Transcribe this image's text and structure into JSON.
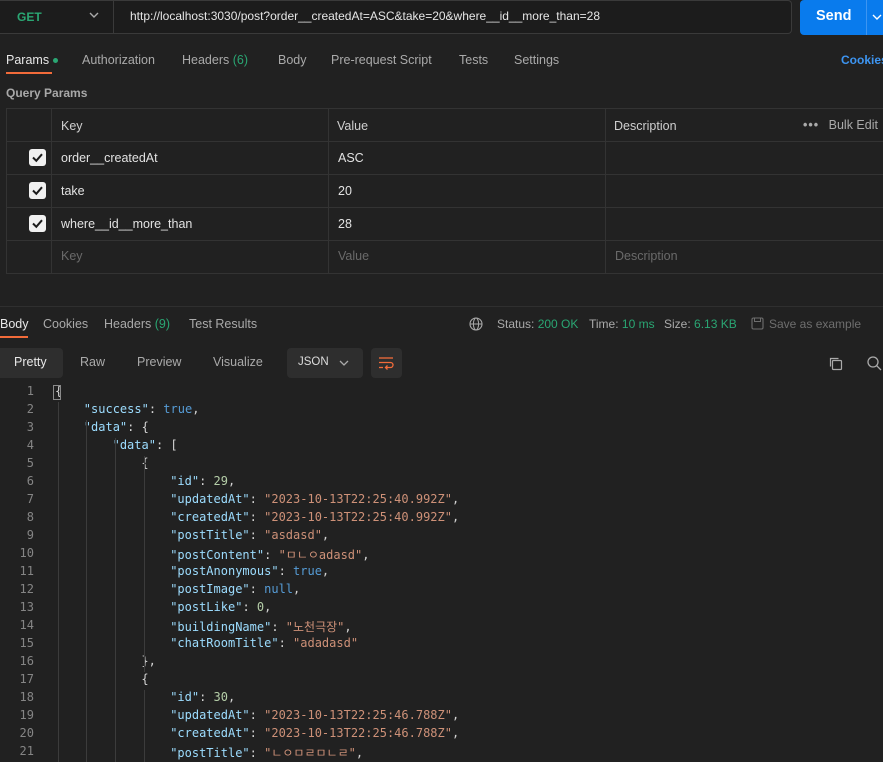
{
  "request": {
    "method": "GET",
    "url": "http://localhost:3030/post?order__createdAt=ASC&take=20&where__id__more_than=28",
    "send_label": "Send"
  },
  "tabs": {
    "params": "Params",
    "authorization": "Authorization",
    "headers": "Headers",
    "headers_count": "(6)",
    "body": "Body",
    "pre_request": "Pre-request Script",
    "tests": "Tests",
    "settings": "Settings",
    "cookies": "Cookies"
  },
  "query_params": {
    "title": "Query Params",
    "columns": {
      "key": "Key",
      "value": "Value",
      "description": "Description"
    },
    "bulk_edit": "Bulk Edit",
    "rows": [
      {
        "key": "order__createdAt",
        "value": "ASC",
        "checked": true
      },
      {
        "key": "take",
        "value": "20",
        "checked": true
      },
      {
        "key": "where__id__more_than",
        "value": "28",
        "checked": true
      }
    ],
    "placeholder": {
      "key": "Key",
      "value": "Value",
      "description": "Description"
    }
  },
  "response": {
    "tabs": {
      "body": "Body",
      "cookies": "Cookies",
      "headers": "Headers",
      "headers_count": "(9)",
      "test_results": "Test Results"
    },
    "status_label": "Status:",
    "status_value": "200 OK",
    "time_label": "Time:",
    "time_value": "10 ms",
    "size_label": "Size:",
    "size_value": "6.13 KB",
    "save_example": "Save as example",
    "views": {
      "pretty": "Pretty",
      "raw": "Raw",
      "preview": "Preview",
      "visualize": "Visualize"
    },
    "format": "JSON"
  },
  "code_lines": [
    {
      "n": "1",
      "indent": 0,
      "html": "{"
    },
    {
      "n": "2",
      "indent": 1,
      "html": "<span class='k'>\"success\"</span>: <span class='b'>true</span>,"
    },
    {
      "n": "3",
      "indent": 1,
      "html": "<span class='k'>\"data\"</span>: {"
    },
    {
      "n": "4",
      "indent": 2,
      "html": "<span class='k'>\"data\"</span>: ["
    },
    {
      "n": "5",
      "indent": 3,
      "html": "{"
    },
    {
      "n": "6",
      "indent": 4,
      "html": "<span class='k'>\"id\"</span>: <span class='n'>29</span>,"
    },
    {
      "n": "7",
      "indent": 4,
      "html": "<span class='k'>\"updatedAt\"</span>: <span class='s'>\"2023-10-13T22:25:40.992Z\"</span>,"
    },
    {
      "n": "8",
      "indent": 4,
      "html": "<span class='k'>\"createdAt\"</span>: <span class='s'>\"2023-10-13T22:25:40.992Z\"</span>,"
    },
    {
      "n": "9",
      "indent": 4,
      "html": "<span class='k'>\"postTitle\"</span>: <span class='s'>\"asdasd\"</span>,"
    },
    {
      "n": "10",
      "indent": 4,
      "html": "<span class='k'>\"postContent\"</span>: <span class='s'>\"ㅁㄴㅇadasd\"</span>,"
    },
    {
      "n": "11",
      "indent": 4,
      "html": "<span class='k'>\"postAnonymous\"</span>: <span class='b'>true</span>,"
    },
    {
      "n": "12",
      "indent": 4,
      "html": "<span class='k'>\"postImage\"</span>: <span class='b'>null</span>,"
    },
    {
      "n": "13",
      "indent": 4,
      "html": "<span class='k'>\"postLike\"</span>: <span class='n'>0</span>,"
    },
    {
      "n": "14",
      "indent": 4,
      "html": "<span class='k'>\"buildingName\"</span>: <span class='s'>\"노천극장\"</span>,"
    },
    {
      "n": "15",
      "indent": 4,
      "html": "<span class='k'>\"chatRoomTitle\"</span>: <span class='s'>\"adadasd\"</span>"
    },
    {
      "n": "16",
      "indent": 3,
      "html": "},"
    },
    {
      "n": "17",
      "indent": 3,
      "html": "{"
    },
    {
      "n": "18",
      "indent": 4,
      "html": "<span class='k'>\"id\"</span>: <span class='n'>30</span>,"
    },
    {
      "n": "19",
      "indent": 4,
      "html": "<span class='k'>\"updatedAt\"</span>: <span class='s'>\"2023-10-13T22:25:46.788Z\"</span>,"
    },
    {
      "n": "20",
      "indent": 4,
      "html": "<span class='k'>\"createdAt\"</span>: <span class='s'>\"2023-10-13T22:25:46.788Z\"</span>,"
    },
    {
      "n": "21",
      "indent": 4,
      "html": "<span class='k'>\"postTitle\"</span>: <span class='s'>\"ㄴㅇㅁㄹㅁㄴㄹ\"</span>,"
    }
  ],
  "colors": {
    "accent": "#097bed",
    "tab_underline": "#f26b3a",
    "status_ok": "#2aa673",
    "background": "#212121"
  }
}
